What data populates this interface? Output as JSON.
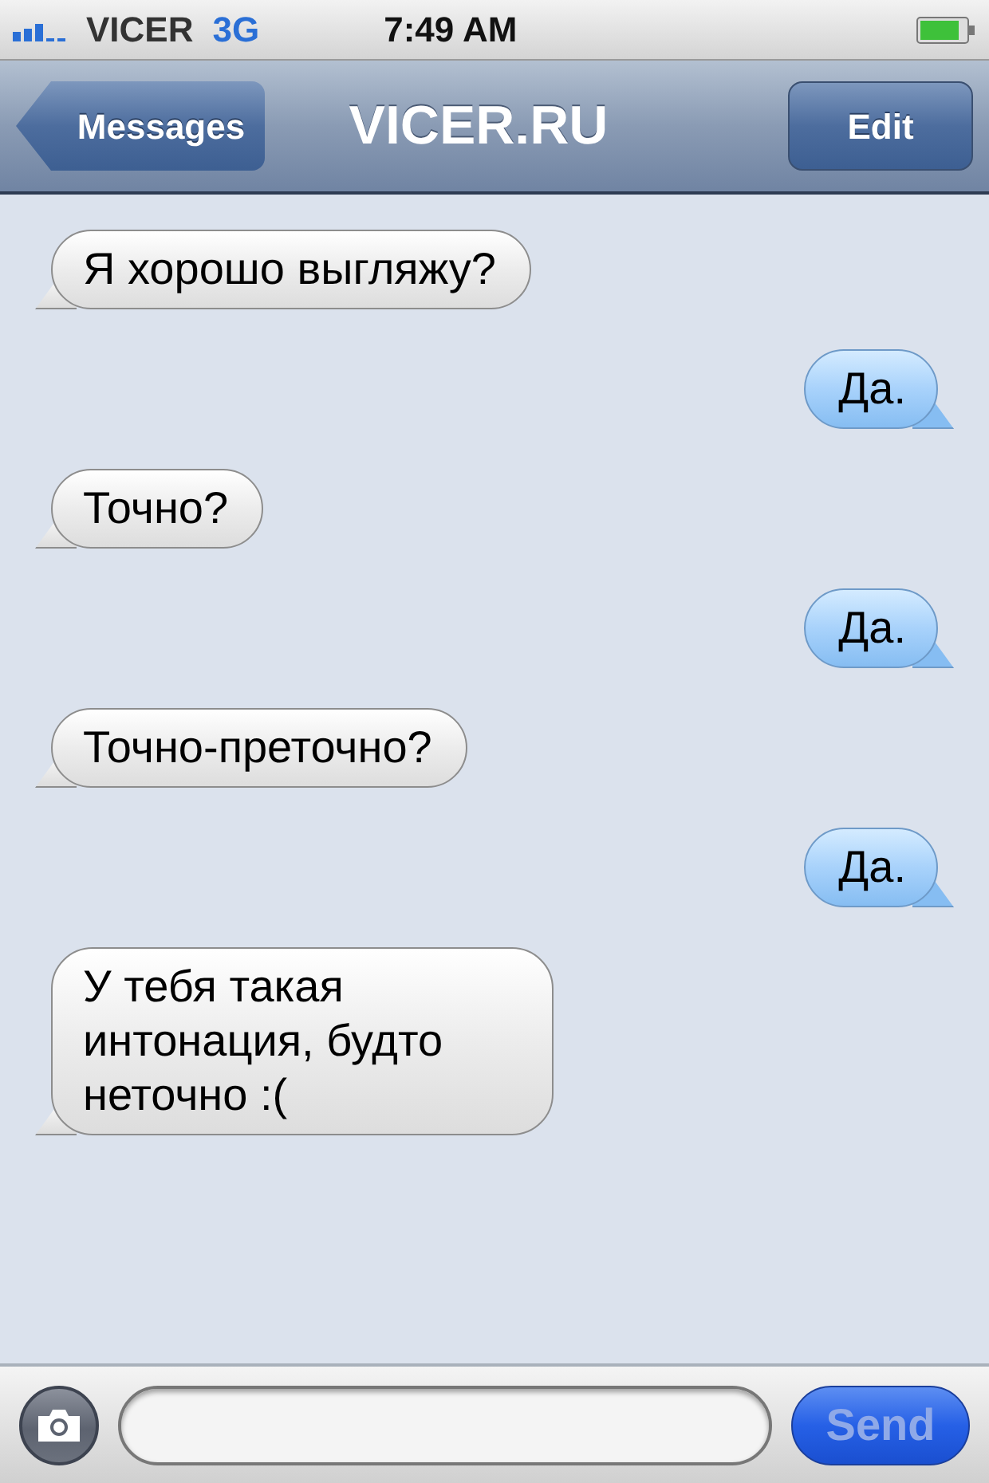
{
  "status_bar": {
    "carrier": "VICER",
    "network": "3G",
    "time": "7:49 AM"
  },
  "nav_bar": {
    "back": "Messages",
    "title": "VICER.RU",
    "action": "Edit"
  },
  "messages": [
    {
      "kind": "incoming",
      "text": "Я хорошо выгляжу?"
    },
    {
      "kind": "outgoing",
      "text": "Да."
    },
    {
      "kind": "incoming",
      "text": "Точно?"
    },
    {
      "kind": "outgoing",
      "text": "Да."
    },
    {
      "kind": "incoming",
      "text": "Точно-преточно?"
    },
    {
      "kind": "outgoing",
      "text": "Да."
    },
    {
      "kind": "incoming",
      "text": "У тебя такая интонация, будто неточно :("
    }
  ],
  "compose": {
    "send": {
      "label": "Send",
      "disabled": true
    }
  }
}
